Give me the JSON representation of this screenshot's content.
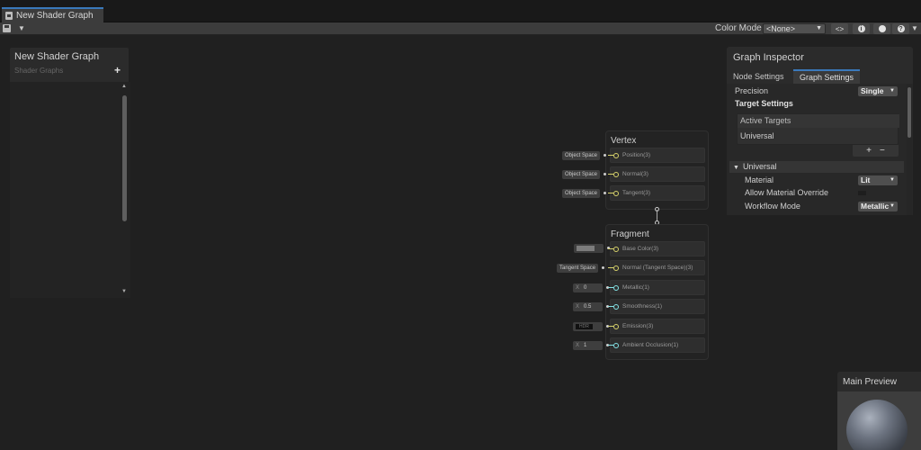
{
  "tab": {
    "title": "New Shader Graph"
  },
  "toolbar": {
    "color_mode_label": "Color Mode",
    "color_mode_value": "<None>",
    "buttons": [
      "link-icon",
      "info-icon",
      "globe-icon",
      "help-icon"
    ]
  },
  "blackboard": {
    "title": "New Shader Graph",
    "subtitle": "Shader Graphs",
    "add_label": "+"
  },
  "vertex": {
    "title": "Vertex",
    "blocks": [
      {
        "label": "Position(3)",
        "input": "Object Space"
      },
      {
        "label": "Normal(3)",
        "input": "Object Space"
      },
      {
        "label": "Tangent(3)",
        "input": "Object Space"
      }
    ]
  },
  "fragment": {
    "title": "Fragment",
    "blocks": [
      {
        "label": "Base Color(3)",
        "input_type": "color",
        "color": "#7c7c7c"
      },
      {
        "label": "Normal (Tangent Space)(3)",
        "input": "Tangent Space"
      },
      {
        "label": "Metallic(1)",
        "axis": "X",
        "input": "0"
      },
      {
        "label": "Smoothness(1)",
        "axis": "X",
        "input": "0.5"
      },
      {
        "label": "Emission(3)",
        "input": "HDR"
      },
      {
        "label": "Ambient Occlusion(1)",
        "axis": "X",
        "input": "1"
      }
    ]
  },
  "inspector": {
    "title": "Graph Inspector",
    "tabs": [
      "Node Settings",
      "Graph Settings"
    ],
    "active_tab": "Graph Settings",
    "precision_label": "Precision",
    "precision_value": "Single",
    "target_settings": "Target Settings",
    "active_targets": "Active Targets",
    "target_item": "Universal",
    "add": "+",
    "remove": "−",
    "universal_section": "Universal",
    "material_label": "Material",
    "material_value": "Lit",
    "allow_override_label": "Allow Material Override",
    "workflow_label": "Workflow Mode",
    "workflow_value": "Metallic"
  },
  "preview": {
    "title": "Main Preview"
  },
  "colors": {
    "accent": "#3a79bb",
    "port_vector3": "#d8d36b",
    "port_float": "#84e4e7",
    "background": "#202020"
  }
}
